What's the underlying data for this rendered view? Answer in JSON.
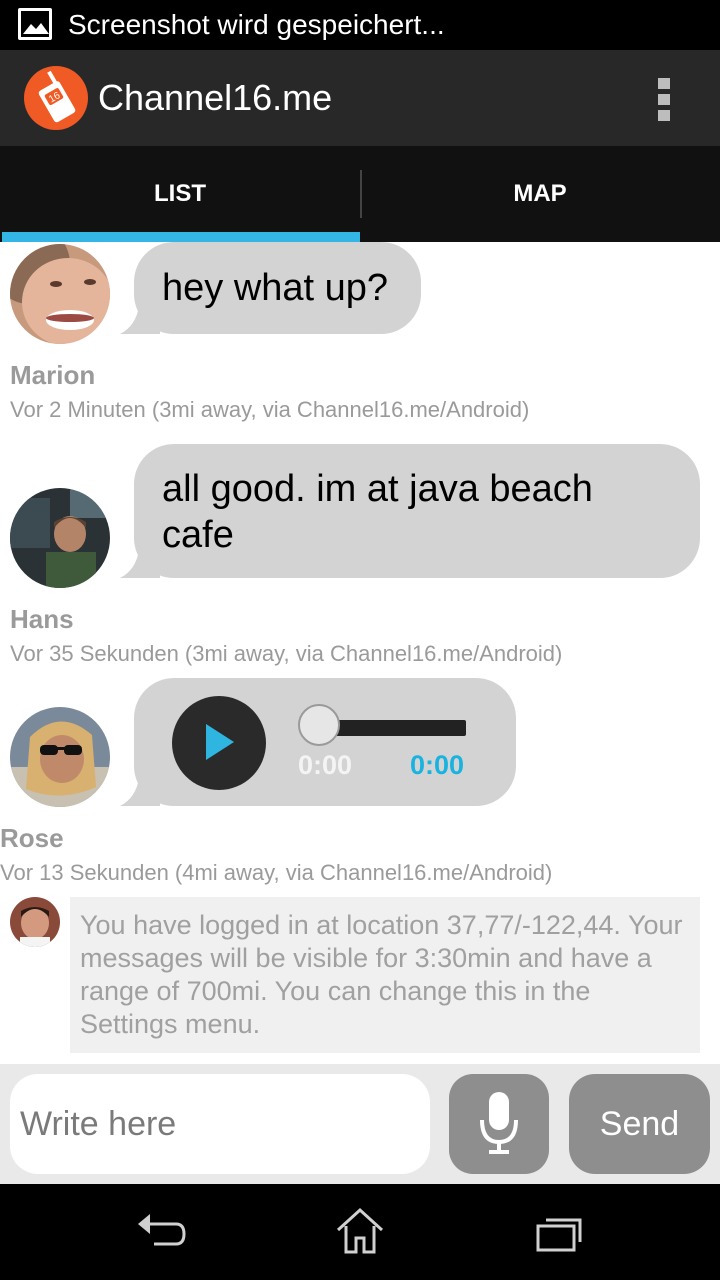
{
  "status_bar": {
    "notification_icon": "image-icon",
    "text": "Screenshot wird gespeichert..."
  },
  "action_bar": {
    "logo_icon": "walkie-talkie-icon",
    "title": "Channel16.me",
    "overflow_icon": "overflow-menu-icon"
  },
  "tabs": [
    {
      "label": "LIST",
      "selected": true
    },
    {
      "label": "MAP",
      "selected": false
    }
  ],
  "colors": {
    "accent": "#33b5e5",
    "brand": "#f05a24",
    "bubble": "#d3d3d3",
    "duration": "#1ab2df"
  },
  "messages": [
    {
      "sender": "Marion",
      "text": "hey what up?",
      "meta": "Vor 2 Minuten  (3mi away, via Channel16.me/Android)"
    },
    {
      "sender": "Hans",
      "text": "all good. im at java beach cafe",
      "meta": "Vor 35 Sekunden  (3mi away, via Channel16.me/Android)"
    },
    {
      "sender": "Rose",
      "type": "audio",
      "time_current": "0:00",
      "time_duration": "0:00",
      "progress": 0,
      "meta": "Vor 13 Sekunden  (4mi away, via Channel16.me/Android)"
    }
  ],
  "system_message": {
    "text": "You have logged in at location 37,77/-122,44. Your messages will be visible for 3:30min and have a range of 700mi. You can change this in the Settings menu."
  },
  "composer": {
    "placeholder": "Write here",
    "mic_icon": "microphone-icon",
    "send_label": "Send"
  },
  "nav_bar": {
    "back_icon": "back-icon",
    "home_icon": "home-icon",
    "recent_icon": "recent-apps-icon"
  }
}
